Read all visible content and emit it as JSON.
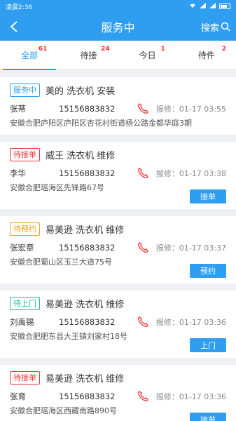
{
  "statusbar": {
    "time": "凌晨2:36"
  },
  "header": {
    "title": "服务中",
    "search_label": "搜索"
  },
  "tabs": [
    {
      "label": "全部",
      "count": "61",
      "active": true
    },
    {
      "label": "待接",
      "count": "24",
      "active": false
    },
    {
      "label": "今日",
      "count": "1",
      "active": false
    },
    {
      "label": "待件",
      "count": "2",
      "active": false
    }
  ],
  "orders": [
    {
      "status": "服务中",
      "status_color": "blue",
      "task": "美的 洗衣机 安装",
      "name": "张蒂",
      "phone": "15156883832",
      "date": "报修：01-17 03:55",
      "address": "安徽合肥庐阳区庐阳区杏花村街道杨公路金都华庭3期",
      "action": ""
    },
    {
      "status": "待接单",
      "status_color": "red",
      "task": "威王 洗衣机 维修",
      "name": "李华",
      "phone": "15156883832",
      "date": "报修：01-17 03:38",
      "address": "安徽合肥瑶海区先锋路67号",
      "action": "接单"
    },
    {
      "status": "待预约",
      "status_color": "orange",
      "task": "易美逊 洗衣机 维修",
      "name": "张宏章",
      "phone": "15156883832",
      "date": "报修：01-17 03:37",
      "address": "安徽合肥蜀山区玉兰大道75号",
      "action": "预约"
    },
    {
      "status": "待上门",
      "status_color": "green",
      "task": "易美逊 洗衣机 维修",
      "name": "刘禹锡",
      "phone": "15156883832",
      "date": "报修：01-17 03:36",
      "address": "安徽合肥肥东县大王镇刘家村18号",
      "action": "上门"
    },
    {
      "status": "待接单",
      "status_color": "red",
      "task": "易美逊 洗衣机 维修",
      "name": "张育",
      "phone": "15156883832",
      "date": "报修：01-17 03:36",
      "address": "安徽合肥瑶海区西藏南路890号",
      "action": "接单"
    }
  ]
}
